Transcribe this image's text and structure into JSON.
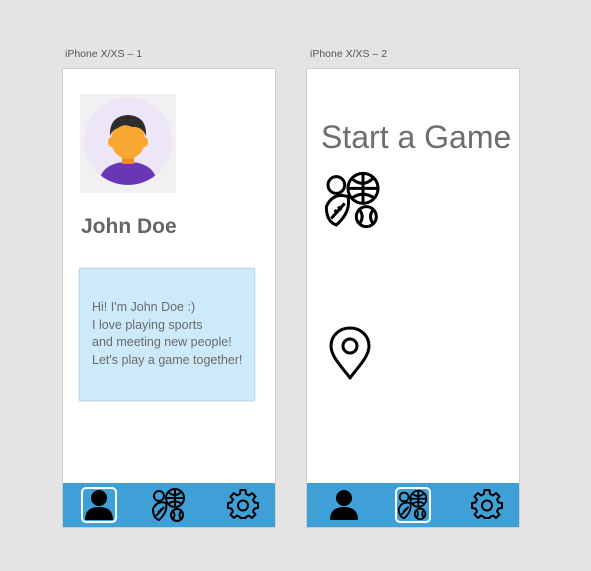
{
  "frames": [
    {
      "label": "iPhone X/XS – 1"
    },
    {
      "label": "iPhone X/XS – 2"
    }
  ],
  "profile": {
    "name": "John Doe",
    "bio_lines": [
      "Hi! I'm John Doe :)",
      "I love playing sports",
      "and meeting new people!",
      "Let's play a game together!"
    ]
  },
  "game": {
    "title": "Start a Game",
    "icons": [
      "sports-icon",
      "location-pin-icon"
    ]
  },
  "tabbar": {
    "icons": [
      "person-icon",
      "sports-icon",
      "gear-icon"
    ],
    "frame1_active": "person-icon",
    "frame2_active": "sports-icon"
  },
  "colors": {
    "tabbar": "#3fa0d8",
    "bio_background": "#cdeafb",
    "avatar_background": "#ece6f7",
    "shirt": "#6a36b8",
    "skin": "#f8a832"
  }
}
